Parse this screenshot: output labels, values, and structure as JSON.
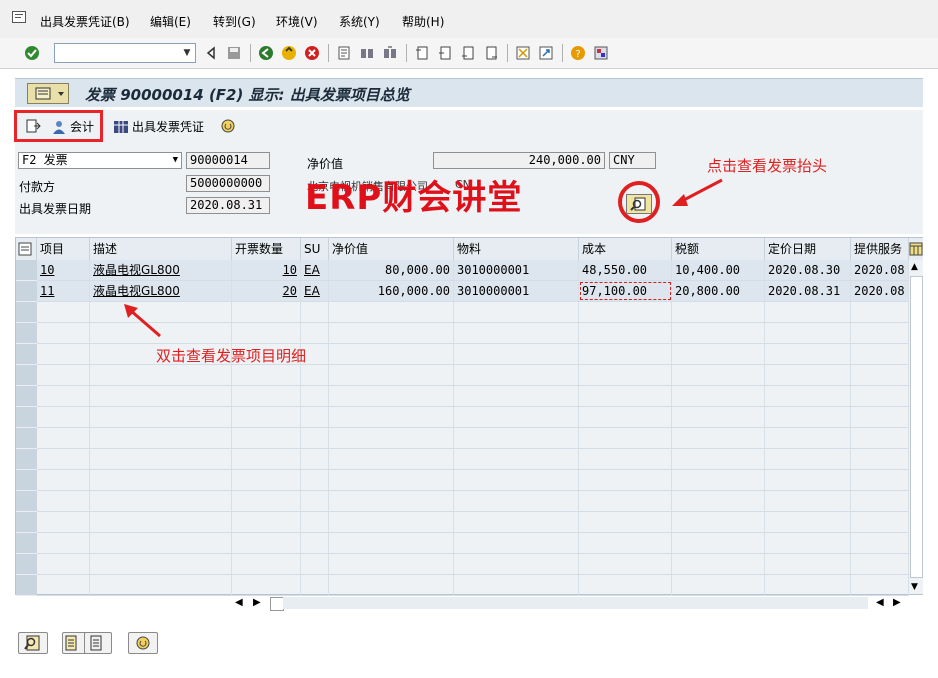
{
  "menu": {
    "items": [
      "出具发票凭证(B)",
      "编辑(E)",
      "转到(G)",
      "环境(V)",
      "系统(Y)",
      "帮助(H)"
    ]
  },
  "toolbar": {
    "command_field": ""
  },
  "title": {
    "text": "发票 90000014  (F2) 显示: 出具发票项目总览"
  },
  "app_toolbar": {
    "accounting_label": "会计",
    "billing_doc_label": "出具发票凭证"
  },
  "header": {
    "doc_type_value": "F2 发票",
    "doc_number": "90000014",
    "payer_label": "付款方",
    "payer_value": "5000000000",
    "billing_date_label": "出具发票日期",
    "billing_date_value": "2020.08.31",
    "net_value_label": "净价值",
    "net_value": "240,000.00",
    "currency": "CNY",
    "partial_label": "北京电视机销售有限公司",
    "partial_currency": "CN"
  },
  "watermark": "ERP财会讲堂",
  "annotations": {
    "header_hint": "点击查看发票抬头",
    "item_hint": "双击查看发票项目明细"
  },
  "table": {
    "columns": [
      "项目",
      "描述",
      "开票数量",
      "SU",
      "净价值",
      "物料",
      "成本",
      "税额",
      "定价日期",
      "提供服务"
    ],
    "rows": [
      [
        "10",
        "液晶电视GL800",
        "10",
        "EA",
        "80,000.00",
        "3010000001",
        "48,550.00",
        "10,400.00",
        "2020.08.30",
        "2020.08"
      ],
      [
        "11",
        "液晶电视GL800",
        "20",
        "EA",
        "160,000.00",
        "3010000001",
        "97,100.00",
        "20,800.00",
        "2020.08.31",
        "2020.08"
      ]
    ]
  },
  "colors": {
    "annotation_red": "#e02020",
    "title_bar": "#dbe5ee"
  }
}
